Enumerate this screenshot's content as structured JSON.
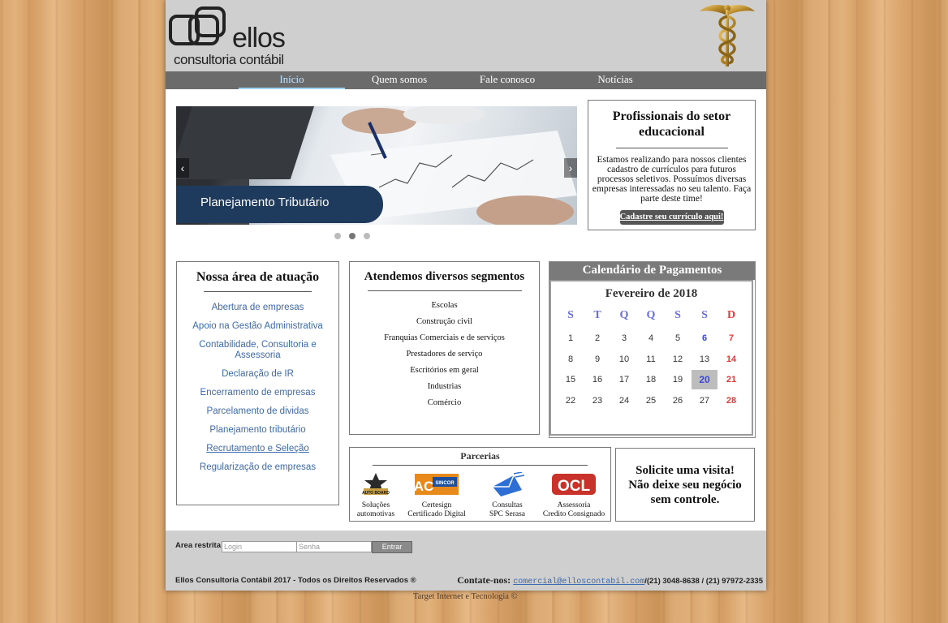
{
  "header": {
    "logo_text": "ellos",
    "logo_sub": "consultoria contábil"
  },
  "nav": {
    "items": [
      {
        "label": "Início",
        "active": true
      },
      {
        "label": "Quem somos",
        "active": false
      },
      {
        "label": "Fale conosco",
        "active": false
      },
      {
        "label": "Notícias",
        "active": false
      }
    ]
  },
  "slider": {
    "caption": "Planejamento Tributário",
    "prev": "‹",
    "next": "›",
    "dots": 3,
    "active_dot": 2
  },
  "professionals": {
    "title": "Profissionais do setor educacional",
    "text": "Estamos realizando para nossos clientes cadastro de currículos para futuros processos seletivos. Possuímos diversas empresas interessadas no seu talento. Faça parte deste time!",
    "button": "Cadastre seu currículo aqui!"
  },
  "area": {
    "title": "Nossa área de atuação",
    "items": [
      "Abertura de empresas",
      "Apoio na Gestão Administrativa",
      "Contabilidade, Consultoria e Assessoria",
      "Declaração de IR",
      "Encerramento de empresas",
      "Parcelamento de dividas",
      "Planejamento tributário",
      "Recrutamento e Seleção",
      "Regularização de empresas"
    ]
  },
  "segments": {
    "title": "Atendemos diversos segmentos",
    "items": [
      "Escolas",
      "Construção civil",
      "Franquias Comerciais e de serviços",
      "Prestadores de serviço",
      "Escritórios em geral",
      "Industrias",
      "Comércio"
    ]
  },
  "calendar": {
    "title": "Calendário de Pagamentos",
    "month": "Fevereiro de 2018",
    "weekdays": [
      "S",
      "T",
      "Q",
      "Q",
      "S",
      "S",
      "D"
    ],
    "weeks": [
      [
        "1",
        "2",
        "3",
        "4",
        "5",
        "6",
        "7"
      ],
      [
        "8",
        "9",
        "10",
        "11",
        "12",
        "13",
        "14"
      ],
      [
        "15",
        "16",
        "17",
        "18",
        "19",
        "20",
        "21"
      ],
      [
        "22",
        "23",
        "24",
        "25",
        "26",
        "27",
        "28"
      ]
    ],
    "highlighted_day": "20",
    "colors": {
      "weekday": "#6a6fd8",
      "sunday": "#e03a3a",
      "saturday_bold": "#3a48e0",
      "highlight_bg": "#bdbdbd"
    }
  },
  "partners": {
    "title": "Parcerias",
    "items": [
      {
        "line1": "Soluções",
        "line2": "automotivas",
        "icon": "auto-board-logo"
      },
      {
        "line1": "Certesign",
        "line2": "Certificado Digital",
        "icon": "ac-sincor-logo"
      },
      {
        "line1": "Consultas",
        "line2": "SPC Serasa",
        "icon": "envelope-logo"
      },
      {
        "line1": "Assessoria",
        "line2": "Credito Consignado",
        "icon": "ocl-logo"
      }
    ],
    "logo_texts": {
      "auto": "AUTO BOARD",
      "ac": "AC",
      "sincor": "SINCOR",
      "ocl": "OCL"
    }
  },
  "visit": {
    "line1": "Solicite uma visita!",
    "line2": "Não deixe seu negócio",
    "line3": "sem controle."
  },
  "footer": {
    "restricted_label": "Area restrita:",
    "login_placeholder": "Login",
    "password_placeholder": "Senha",
    "enter_button": "Entrar",
    "copyright": "Ellos Consultoria Contábil 2017 - Todos os Direitos Reservados ®",
    "contact_label": "Contate-nos:",
    "email": "comercial@elloscontabil.com",
    "phones": "/(21) 3048-8638 / (21) 97972-2335"
  },
  "credit": "Target Internet e Tecnologia ©"
}
